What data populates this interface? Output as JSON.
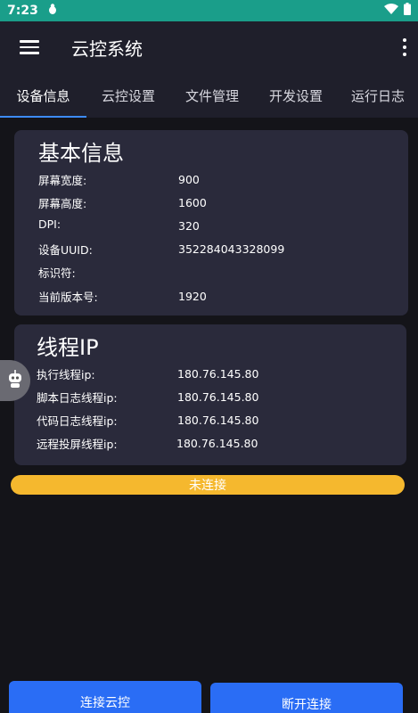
{
  "status_bar": {
    "time": "7:23"
  },
  "app_bar": {
    "title": "云控系统"
  },
  "tabs": [
    {
      "label": "设备信息"
    },
    {
      "label": "云控设置"
    },
    {
      "label": "文件管理"
    },
    {
      "label": "开发设置"
    },
    {
      "label": "运行日志"
    }
  ],
  "basic_info": {
    "title": "基本信息",
    "rows": [
      {
        "label": "屏幕宽度:",
        "value": "900"
      },
      {
        "label": "屏幕高度:",
        "value": "1600"
      },
      {
        "label": "DPI:",
        "value": "320"
      },
      {
        "label": "设备UUID:",
        "value": "352284043328099"
      },
      {
        "label": "标识符:",
        "value": ""
      },
      {
        "label": "当前版本号:",
        "value": "1920"
      }
    ]
  },
  "thread_ip": {
    "title": "线程IP",
    "rows": [
      {
        "label": "执行线程ip:",
        "value": "180.76.145.80"
      },
      {
        "label": "脚本日志线程ip:",
        "value": "180.76.145.80"
      },
      {
        "label": "代码日志线程ip:",
        "value": "180.76.145.80"
      },
      {
        "label": "远程投屏线程ip:",
        "value": "180.76.145.80"
      }
    ]
  },
  "connection_status": "未连接",
  "buttons": {
    "connect": "连接云控",
    "disconnect": "断开连接"
  },
  "colors": {
    "status_bar": "#1a9e8a",
    "app_bar": "#1f1f2b",
    "card": "#2a2a3b",
    "status_strip": "#f5b82e",
    "button": "#2a6df5",
    "tab_indicator": "#3d8bff"
  }
}
